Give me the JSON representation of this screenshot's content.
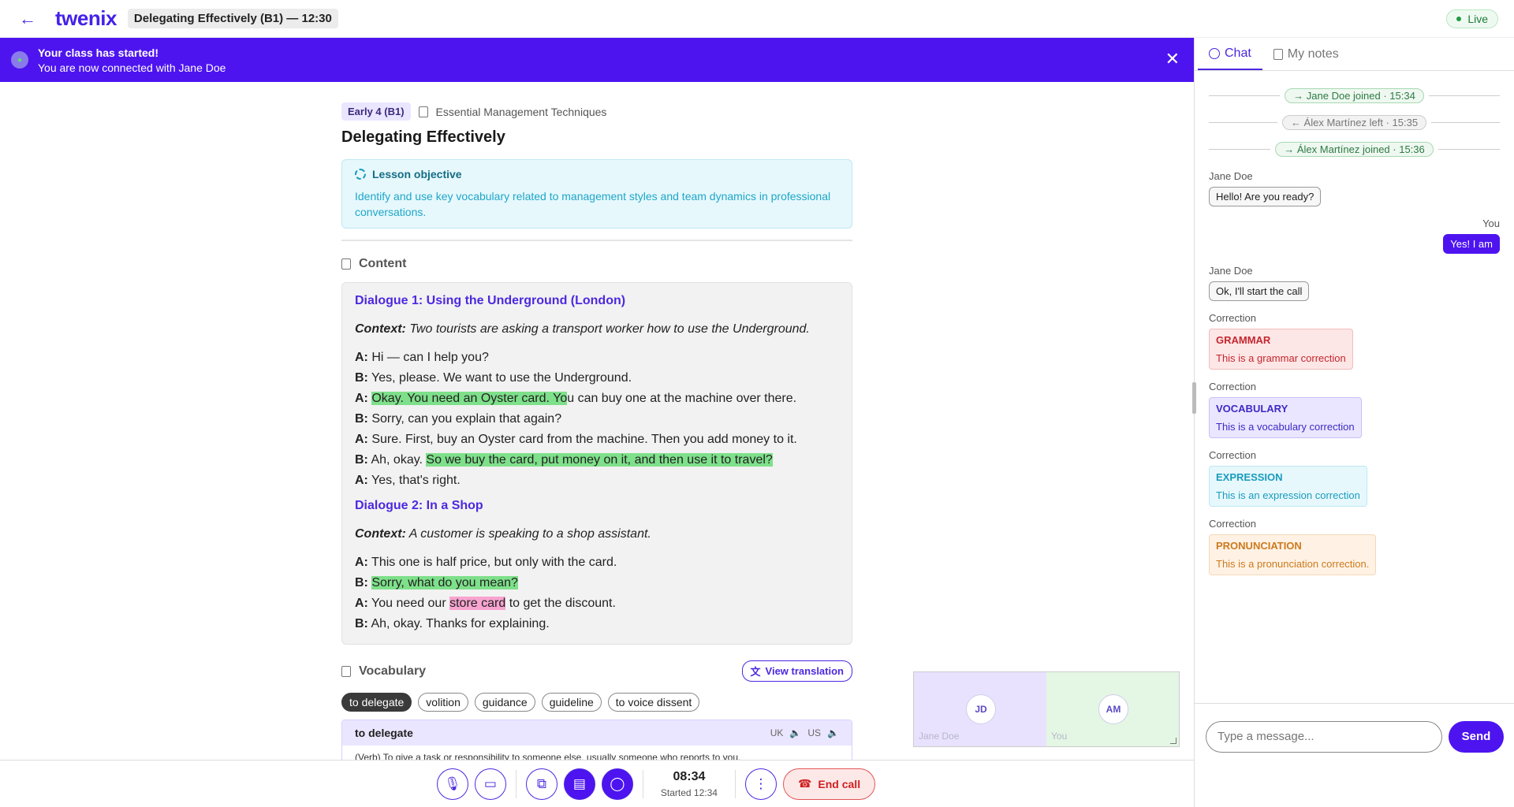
{
  "header": {
    "back_icon": "←",
    "logo": "twenix",
    "lesson_title": "Delegating Effectively (B1) — 12:30",
    "live_label": "Live"
  },
  "banner": {
    "title": "Your class has started!",
    "subtitle": "You are now connected with Jane Doe",
    "close_icon": "✕"
  },
  "lesson": {
    "level": "Early 4 (B1)",
    "course": "Essential Management Techniques",
    "title": "Delegating Effectively",
    "objective_label": "Lesson objective",
    "objective_text": "Identify and use key vocabulary related to management styles and team dynamics in professional conversations.",
    "content_label": "Content",
    "dialogue1": {
      "title": "Dialogue 1: Using the Underground (London)",
      "context_label": "Context:",
      "context": "Two tourists are asking a transport worker how to use the Underground.",
      "l1": {
        "s": "A:",
        "t": "Hi — can I help you?"
      },
      "l2": {
        "s": "B:",
        "t": "Yes, please. We want to use the Underground."
      },
      "l3": {
        "s": "A:",
        "h": "Okay. You need an Oyster card. Yo",
        "t": "u can buy one at the machine over there."
      },
      "l4": {
        "s": "B:",
        "t": "Sorry, can you explain that again?"
      },
      "l5": {
        "s": "A:",
        "t": "Sure. First, buy an Oyster card from the machine. Then you add money to it."
      },
      "l6": {
        "s": "B:",
        "a": "Ah, okay.",
        "h": "So we buy the card, put money on it, and then use it to travel?"
      },
      "l7": {
        "s": "A:",
        "t": "Yes, that's right."
      }
    },
    "dialogue2": {
      "title": "Dialogue 2: In a Shop",
      "context_label": "Context:",
      "context": "A customer is speaking to a shop assistant.",
      "l1": {
        "s": "A:",
        "t": "This one is half price, but only with the card."
      },
      "l2": {
        "s": "B:",
        "h": "Sorry, what do you mean?"
      },
      "l3": {
        "s": "A:",
        "a": "You need our",
        "p": "store card",
        "t": "to get the discount."
      },
      "l4": {
        "s": "B:",
        "t": "Ah, okay. Thanks for explaining."
      }
    },
    "vocab_label": "Vocabulary",
    "view_translation": "View translation",
    "chips": [
      "to delegate",
      "volition",
      "guidance",
      "guideline",
      "to voice dissent"
    ],
    "word": "to delegate",
    "accent_uk": "UK",
    "accent_us": "US",
    "definition": "(Verb) To give a task or responsibility to someone else, usually someone who reports to you."
  },
  "video": {
    "left_initials": "JD",
    "left_name": "Jane Doe",
    "right_initials": "AM",
    "right_name": "You"
  },
  "controls": {
    "timer": "08:34",
    "started": "Started 12:34",
    "end_call": "End call"
  },
  "sidebar": {
    "tab_chat": "Chat",
    "tab_notes": "My notes",
    "sys1": "→ Jane Doe joined · 15:34",
    "sys2": "← Álex Martínez left · 15:35",
    "sys3": "→ Álex Martínez joined · 15:36",
    "m1_who": "Jane Doe",
    "m1": "Hello! Are you ready?",
    "m2_who": "You",
    "m2": "Yes! I am",
    "m3_who": "Jane Doe",
    "m3": "Ok, I'll start the call",
    "corr_label": "Correction",
    "c1_type": "GRAMMAR",
    "c1_text": "This is a grammar correction",
    "c2_type": "VOCABULARY",
    "c2_text": "This is a vocabulary correction",
    "c3_type": "EXPRESSION",
    "c3_text": "This is an expression correction",
    "c4_type": "PRONUNCIATION",
    "c4_text": "This is a pronunciation correction.",
    "placeholder": "Type a message...",
    "send": "Send"
  }
}
